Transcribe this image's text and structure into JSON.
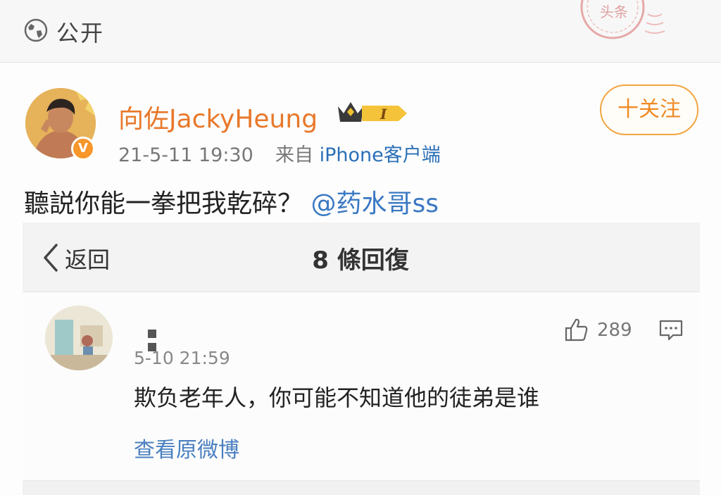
{
  "visibility": {
    "label": "公开",
    "icon": "globe-icon"
  },
  "watermark": {
    "text": "头条"
  },
  "post": {
    "username": "向佐JackyHeung",
    "member_level": "I",
    "date": "21-5-11 19:30",
    "source_prefix": "来自",
    "source": "iPhone客户端",
    "follow_label": "十关注",
    "text": "聽説你能一拳把我乾碎？",
    "mention": "@药水哥ss"
  },
  "replies_panel": {
    "back_label": "返回",
    "title": "8 條回復"
  },
  "comment": {
    "time": "5-10 21:59",
    "likes": "289",
    "text": "欺负老年人，你可能不知道他的徒弟是谁",
    "link": "查看原微博"
  },
  "colors": {
    "accent_orange": "#f08a24",
    "link_blue": "#3a78c3"
  }
}
